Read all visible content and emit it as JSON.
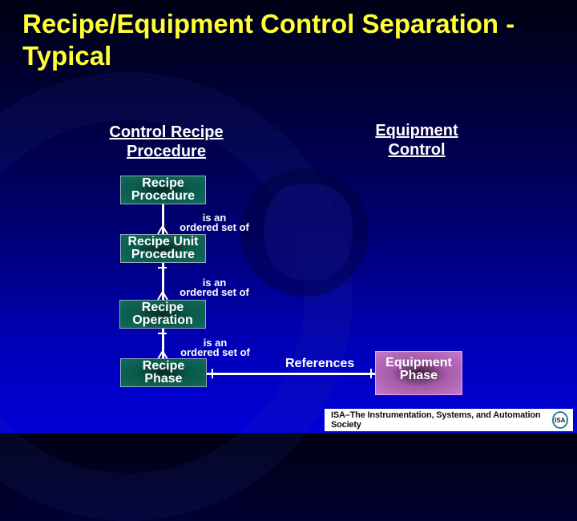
{
  "title": "Recipe/Equipment Control Separation - Typical",
  "headings": {
    "left": [
      "Control Recipe",
      "Procedure"
    ],
    "right": [
      "Equipment",
      "Control"
    ]
  },
  "boxes": {
    "recipe_procedure": [
      "Recipe",
      "Procedure"
    ],
    "recipe_unit_procedure": [
      "Recipe Unit",
      "Procedure"
    ],
    "recipe_operation": [
      "Recipe",
      "Operation"
    ],
    "recipe_phase": [
      "Recipe",
      "Phase"
    ],
    "equipment_phase": [
      "Equipment",
      "Phase"
    ]
  },
  "relations": {
    "ordered_set": [
      "is an",
      "ordered set of"
    ],
    "references": "References"
  },
  "colors": {
    "title": "#ffff33",
    "recipe_box": "#0f6b5a",
    "equipment_box": "#c47ac8"
  },
  "footer": {
    "text": "ISA–The Instrumentation, Systems, and Automation Society",
    "logo": "ISA"
  }
}
